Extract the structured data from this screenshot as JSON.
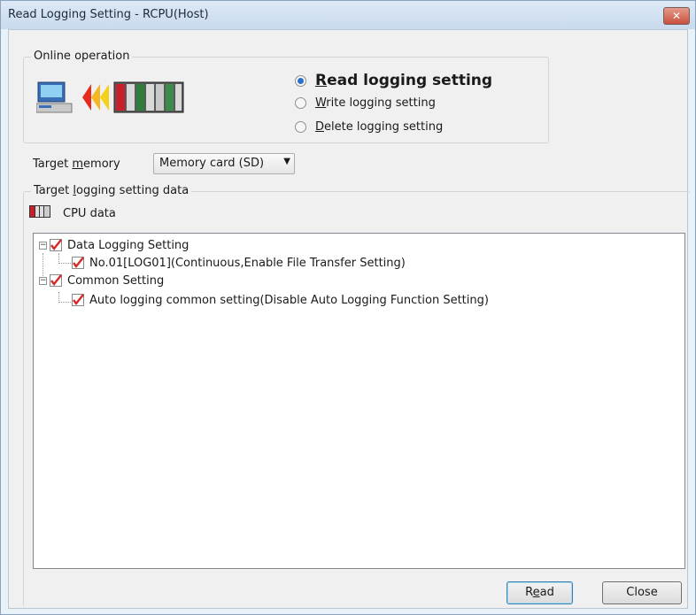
{
  "window": {
    "title": "Read Logging Setting - RCPU(Host)",
    "close_icon": "close-icon"
  },
  "online_operation": {
    "label": "Online operation",
    "options": [
      {
        "label_rest": "ead logging setting",
        "mnemonic": "R",
        "selected": true
      },
      {
        "label_rest": "rite logging setting",
        "mnemonic": "W",
        "selected": false
      },
      {
        "label_rest": "elete logging setting",
        "mnemonic": "D",
        "selected": false
      }
    ]
  },
  "target_memory": {
    "label_pre": "Target ",
    "label_mnemonic": "m",
    "label_post": "emory",
    "value": "Memory card (SD)"
  },
  "target_data": {
    "label_pre": "Target ",
    "label_mnemonic": "l",
    "label_post": "ogging setting data",
    "cpu_label": "CPU data",
    "tree": [
      {
        "text": "Data Logging Setting",
        "level": 0,
        "checked": true,
        "expander": "−"
      },
      {
        "text": "No.01[LOG01](Continuous,Enable File Transfer Setting)",
        "level": 1,
        "checked": true
      },
      {
        "text": "Common Setting",
        "level": 0,
        "checked": true,
        "expander": "−"
      },
      {
        "text": "Auto logging common setting(Disable Auto Logging Function Setting)",
        "level": 1,
        "checked": true
      }
    ]
  },
  "buttons": {
    "read_pre": "R",
    "read_mnemonic": "e",
    "read_post": "ad",
    "close": "Close"
  },
  "colors": {
    "check_red": "#d42a2a",
    "radio_selected": "#2d6ec9"
  }
}
